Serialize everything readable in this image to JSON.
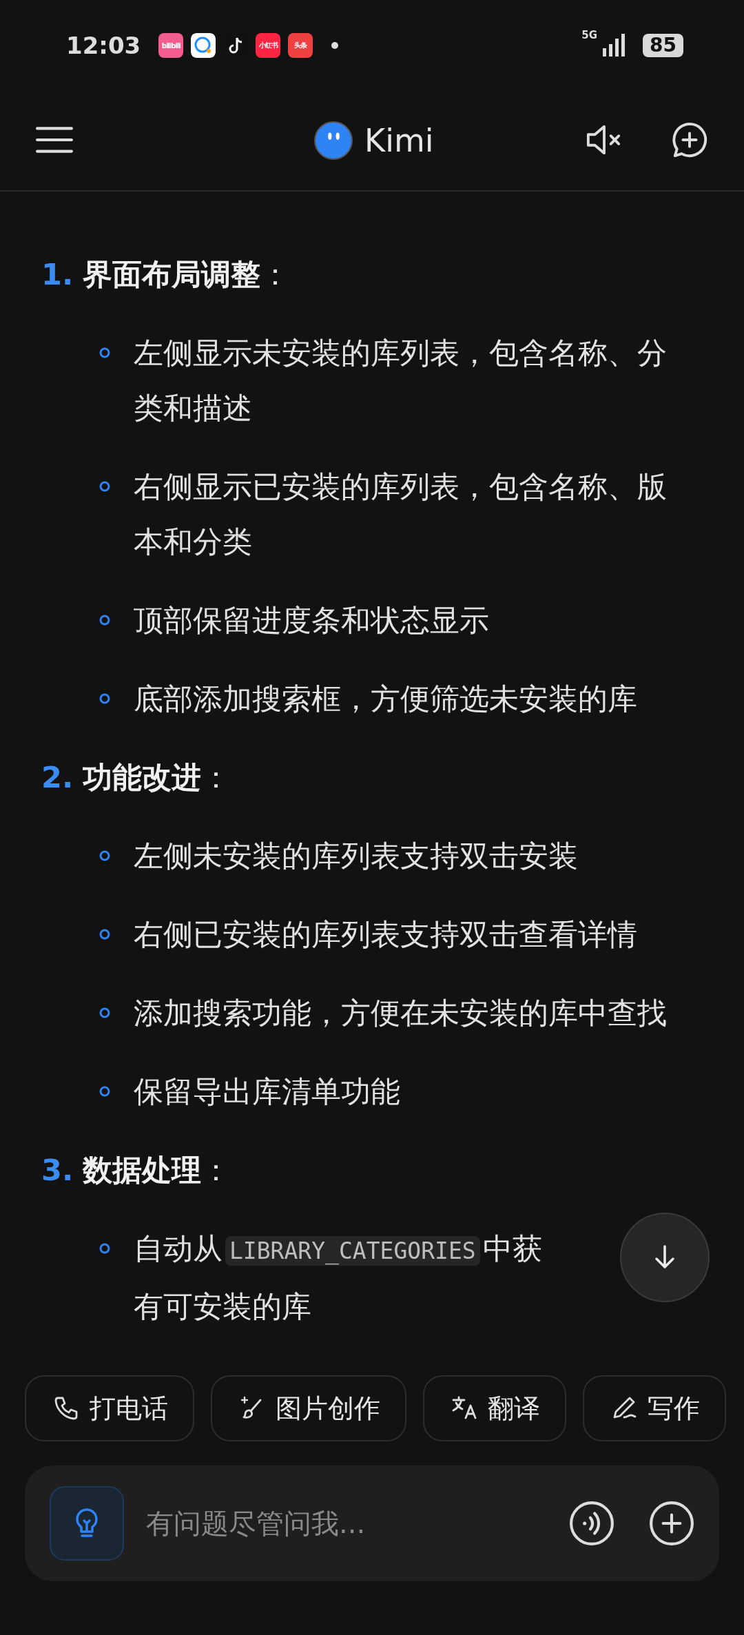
{
  "status_bar": {
    "time": "12:03",
    "apps": [
      {
        "kind": "bilibili",
        "label": "bilibili"
      },
      {
        "kind": "chat"
      },
      {
        "kind": "note"
      },
      {
        "kind": "xiaohongshu",
        "label": "小红书"
      },
      {
        "kind": "toutiao",
        "label": "头条"
      }
    ],
    "network": "5G",
    "battery": "85"
  },
  "header": {
    "title": "Kimi"
  },
  "message": {
    "sections": [
      {
        "number": "1.",
        "title": "**界面布局调整**：",
        "items": [
          {
            "segments": [
              {
                "kind": "text",
                "text": "左侧显示未安装的库列表，包含名称、分类和描述"
              }
            ]
          },
          {
            "segments": [
              {
                "kind": "text",
                "text": "右侧显示已安装的库列表，包含名称、版本和分类"
              }
            ]
          },
          {
            "segments": [
              {
                "kind": "text",
                "text": "顶部保留进度条和状态显示"
              }
            ]
          },
          {
            "segments": [
              {
                "kind": "text",
                "text": "底部添加搜索框，方便筛选未安装的库"
              }
            ]
          }
        ]
      },
      {
        "number": "2.",
        "title": "**功能改进**：",
        "items": [
          {
            "segments": [
              {
                "kind": "text",
                "text": "左侧未安装的库列表支持双击安装"
              }
            ]
          },
          {
            "segments": [
              {
                "kind": "text",
                "text": "右侧已安装的库列表支持双击查看详情"
              }
            ]
          },
          {
            "segments": [
              {
                "kind": "text",
                "text": "添加搜索功能，方便在未安装的库中查找"
              }
            ]
          },
          {
            "segments": [
              {
                "kind": "text",
                "text": "保留导出库清单功能"
              }
            ]
          }
        ]
      },
      {
        "number": "3.",
        "title": "**数据处理**：",
        "items": [
          {
            "segments": [
              {
                "kind": "text",
                "text": "自动从"
              },
              {
                "kind": "code",
                "text": "LIBRARY_CATEGORIES"
              },
              {
                "kind": "text",
                "text": "中获"
              },
              {
                "kind": "line",
                "text": "有可安装的库"
              }
            ]
          }
        ]
      }
    ]
  },
  "chips": [
    {
      "kind": "phone",
      "label": "打电话"
    },
    {
      "kind": "brush",
      "label": "图片创作"
    },
    {
      "kind": "translate",
      "label": "翻译"
    },
    {
      "kind": "pen",
      "label": "写作"
    }
  ],
  "input": {
    "placeholder": "有问题尽管问我..."
  }
}
